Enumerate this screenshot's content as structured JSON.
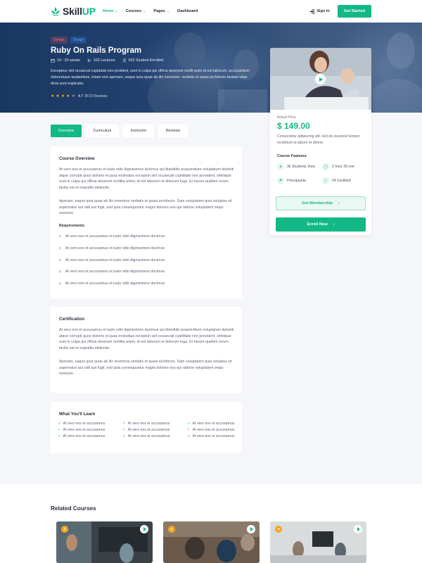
{
  "brand": {
    "part1": "Skill",
    "part2": "UP",
    "accent": "#12b886"
  },
  "nav": {
    "items": [
      {
        "label": "Home",
        "active": true,
        "dropdown": true
      },
      {
        "label": "Courses",
        "active": false,
        "dropdown": true
      },
      {
        "label": "Pages",
        "active": false,
        "dropdown": true
      },
      {
        "label": "Dashboard",
        "active": false,
        "dropdown": false
      }
    ],
    "sign_in": "Sign In",
    "cta": "Get Started"
  },
  "hero": {
    "tags": [
      "Design",
      "Design"
    ],
    "title": "Ruby On Rails Program",
    "meta": {
      "duration": "10 - 20 weeks",
      "lectures": "102 Lectures",
      "students": "502 Student Enrolled"
    },
    "description": "Excepteur sint occaecat cupidatat non proident, sunt in culpa qui officia deserunt mollit anim id est laborum. accusantium doloremque laudantium, totam rem aperiam, eaque ipsa quae ab illo inventore. veritatis et quasi architecto beatae vitae dicta sunt explicabo.",
    "rating": {
      "value": "4.7",
      "stars": 4,
      "reviews": "3572 Reviews"
    }
  },
  "sidebar": {
    "price_label": "Actual Price",
    "price": "$ 149.00",
    "description": "Consectetur adipiscing elit, sed do eiusmod tempor incididunt ut labore et dolore.",
    "features_title": "Course Features",
    "features": [
      "3k Students View",
      "2 hour 30 min",
      "Principiante",
      "04 Certified"
    ],
    "membership_button": "Get Membership",
    "enroll_button": "Enroll Now"
  },
  "tabs": [
    "Overview",
    "Curriculum",
    "Instructor",
    "Reviews"
  ],
  "overview": {
    "title": "Course Overview",
    "para1": "At vero eos et accusamus et iusto odio dignissimos ducimus qui blanditiis praesentium voluptatum deleniti atque corrupti quos dolores et quas molestias excepturi sint occaecati cupiditate non provident, similique sunt in culpa qui officia deserunt mollitia animi, id est laborum et dolorum fuga. Et harum quidem rerum facilis est et expedita distinctio.",
    "para2": "Aperiam, eaque ipsa quae ab illo inventore veritatis et quasi architecto. Sam voluptatem quia voluptas sit aspernatur aut odit aut fugit, sed quia consequuntur magni dolores eos qui ratione voluptatem sequi nesciunt.",
    "requirements_title": "Requirements",
    "requirements": [
      "At vero eos et accusamus et iusto odio dignissimos ducimus",
      "At vero eos et accusamus et iusto odio dignissimos ducimus",
      "At vero eos et accusamus et iusto odio dignissimos ducimus",
      "At vero eos et accusamus et iusto odio dignissimos ducimus",
      "At vero eos et accusamus et iusto odio dignissimos ducimus"
    ]
  },
  "certification": {
    "title": "Certification",
    "para1": "At vero eos et accusamus et iusto odio dignissimos ducimus qui blanditiis praesentium voluptatum deleniti atque corrupti quos dolores et quas molestias excepturi sint occaecati cupiditate non provident, similique sunt in culpa qui officia deserunt mollitia animi, id est laborum et dolorum fuga. Et harum quidem rerum facilis est et expedita distinctio.",
    "para2": "Aperiam, eaque ipsa quae ab illo inventore veritatis et quasi architecto. Sam voluptatem quia voluptas sit aspernatur aut odit aut fugit, sed quia consequuntur magni dolores eos qui ratione voluptatem sequi nesciunt."
  },
  "learn": {
    "title": "What You'll Learn",
    "items": [
      "At vero eos et accusamus",
      "At vero eos et accusamus",
      "At vero eos et accusamus",
      "At vero eos et accusamus",
      "At vero eos et accusamus",
      "At vero eos et accusamus",
      "At vero eos et accusamus",
      "At vero eos et accusamus",
      "At vero eos et accusamus"
    ]
  },
  "related": {
    "title": "Related Courses"
  }
}
